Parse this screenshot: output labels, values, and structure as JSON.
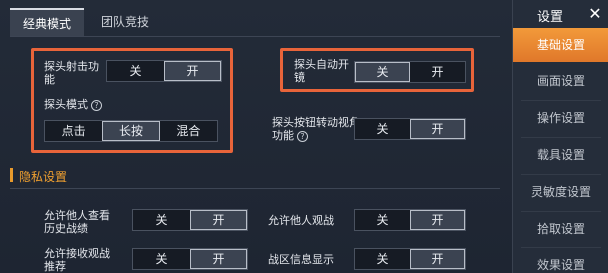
{
  "mode_tabs": {
    "classic": "经典模式",
    "team": "团队竞技"
  },
  "settings": {
    "peek_fire": {
      "label": "探头射击功能",
      "options": [
        "关",
        "开"
      ],
      "selected": "开"
    },
    "peek_mode": {
      "label": "探头模式",
      "options": [
        "点击",
        "长按",
        "混合"
      ],
      "selected": "长按"
    },
    "peek_auto_scope": {
      "label": "探头自动开镜",
      "options": [
        "关",
        "开"
      ],
      "selected": "关"
    },
    "peek_button_rotate": {
      "label": "探头按钮转动视角功能",
      "options": [
        "关",
        "开"
      ],
      "selected": "开"
    }
  },
  "privacy": {
    "title": "隐私设置",
    "view_history": {
      "label": "允许他人查看历史战绩",
      "options": [
        "关",
        "开"
      ],
      "selected": "开"
    },
    "spectate": {
      "label": "允许他人观战",
      "options": [
        "关",
        "开"
      ],
      "selected": "开"
    },
    "receive_spectate": {
      "label": "允许接收观战推荐",
      "options": [
        "关",
        "开"
      ],
      "selected": "开"
    },
    "region_display": {
      "label": "战区信息显示",
      "options": [
        "关",
        "开"
      ],
      "selected": "开"
    }
  },
  "sidebar": {
    "title": "设置",
    "close": "✕",
    "items": [
      {
        "label": "基础设置",
        "active": true
      },
      {
        "label": "画面设置",
        "active": false
      },
      {
        "label": "操作设置",
        "active": false
      },
      {
        "label": "载具设置",
        "active": false
      },
      {
        "label": "灵敏度设置",
        "active": false
      },
      {
        "label": "拾取设置",
        "active": false
      },
      {
        "label": "效果设置",
        "active": false
      }
    ]
  },
  "colors": {
    "accent": "#e8643a",
    "section": "#f0a030",
    "sidebar_active": "#e88a32"
  }
}
